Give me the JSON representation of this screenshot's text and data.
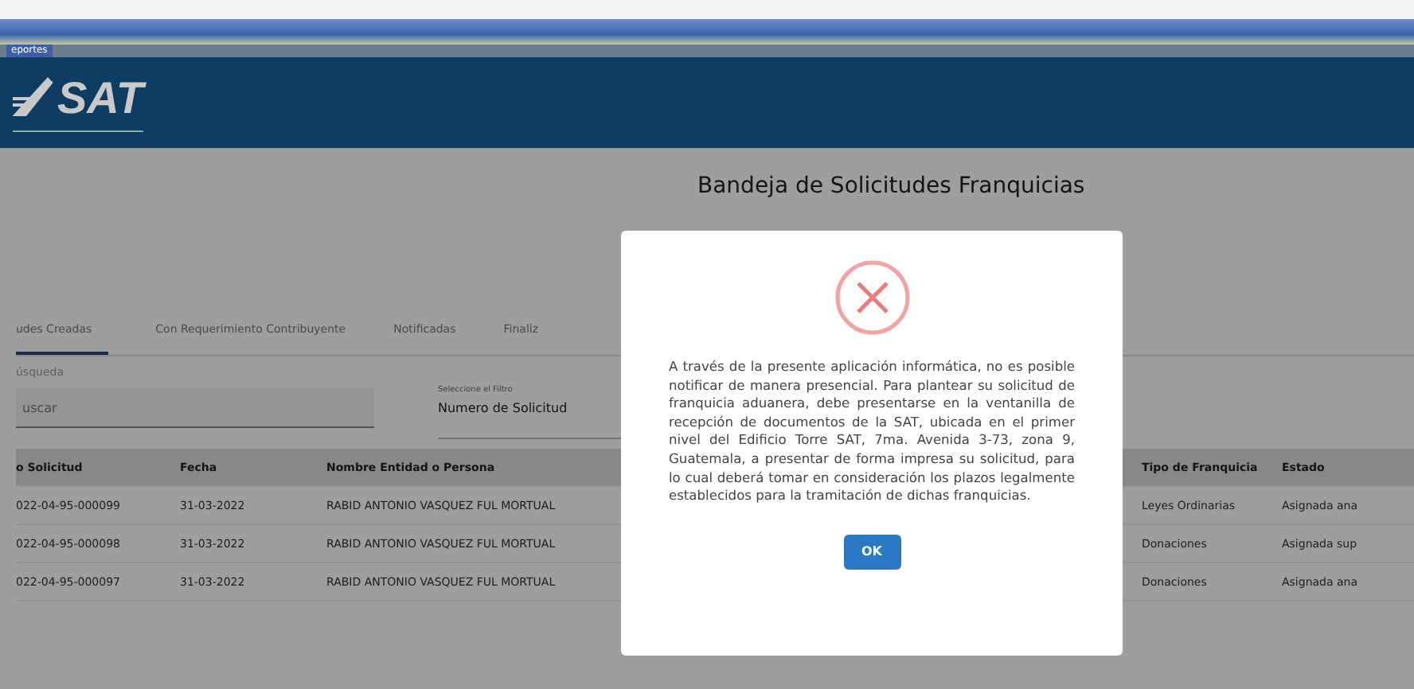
{
  "menu_bar": {
    "items": [
      {
        "label": "eportes",
        "selected": true
      }
    ]
  },
  "header": {
    "logo": "SAT"
  },
  "page": {
    "title": "Bandeja de Solicitudes Franquicias"
  },
  "tabs": [
    {
      "label": "udes Creadas",
      "selected": true
    },
    {
      "label": "Con Requerimiento Contribuyente",
      "selected": false
    },
    {
      "label": "Notificadas",
      "selected": false
    },
    {
      "label": "Finaliz",
      "selected": false
    }
  ],
  "search": {
    "label": "úsqueda",
    "placeholder": "uscar"
  },
  "filter": {
    "label": "Seleccione el Filtro",
    "value": "Numero de Solicitud"
  },
  "table": {
    "columns": [
      "o Solicitud",
      "Fecha",
      "Nombre Entidad o Persona",
      "",
      "Tipo de Franquicia",
      "Estado"
    ],
    "rows": [
      [
        "022-04-95-000099",
        "31-03-2022",
        "RABID ANTONIO VASQUEZ FUL MORTUAL",
        "",
        "Leyes Ordinarias",
        "Asignada ana"
      ],
      [
        "022-04-95-000098",
        "31-03-2022",
        "RABID ANTONIO VASQUEZ FUL MORTUAL",
        "",
        "Donaciones",
        "Asignada sup"
      ],
      [
        "022-04-95-000097",
        "31-03-2022",
        "RABID ANTONIO VASQUEZ FUL MORTUAL",
        "",
        "Donaciones",
        "Asignada ana"
      ]
    ]
  },
  "dialog": {
    "message": "A través de la presente aplicación informática, no es posible notificar de manera presencial. Para plantear su solicitud de franquicia aduanera, debe presentarse en la ventanilla de recepción de documentos de la SAT, ubicada en el primer nivel del Edificio Torre SAT, 7ma. Avenida 3-73, zona 9, Guatemala, a presentar de forma impresa su solicitud, para lo cual deberá tomar en consideración los plazos legalmente establecidos para la tramitación de dichas franquicias.",
    "button": "OK"
  }
}
